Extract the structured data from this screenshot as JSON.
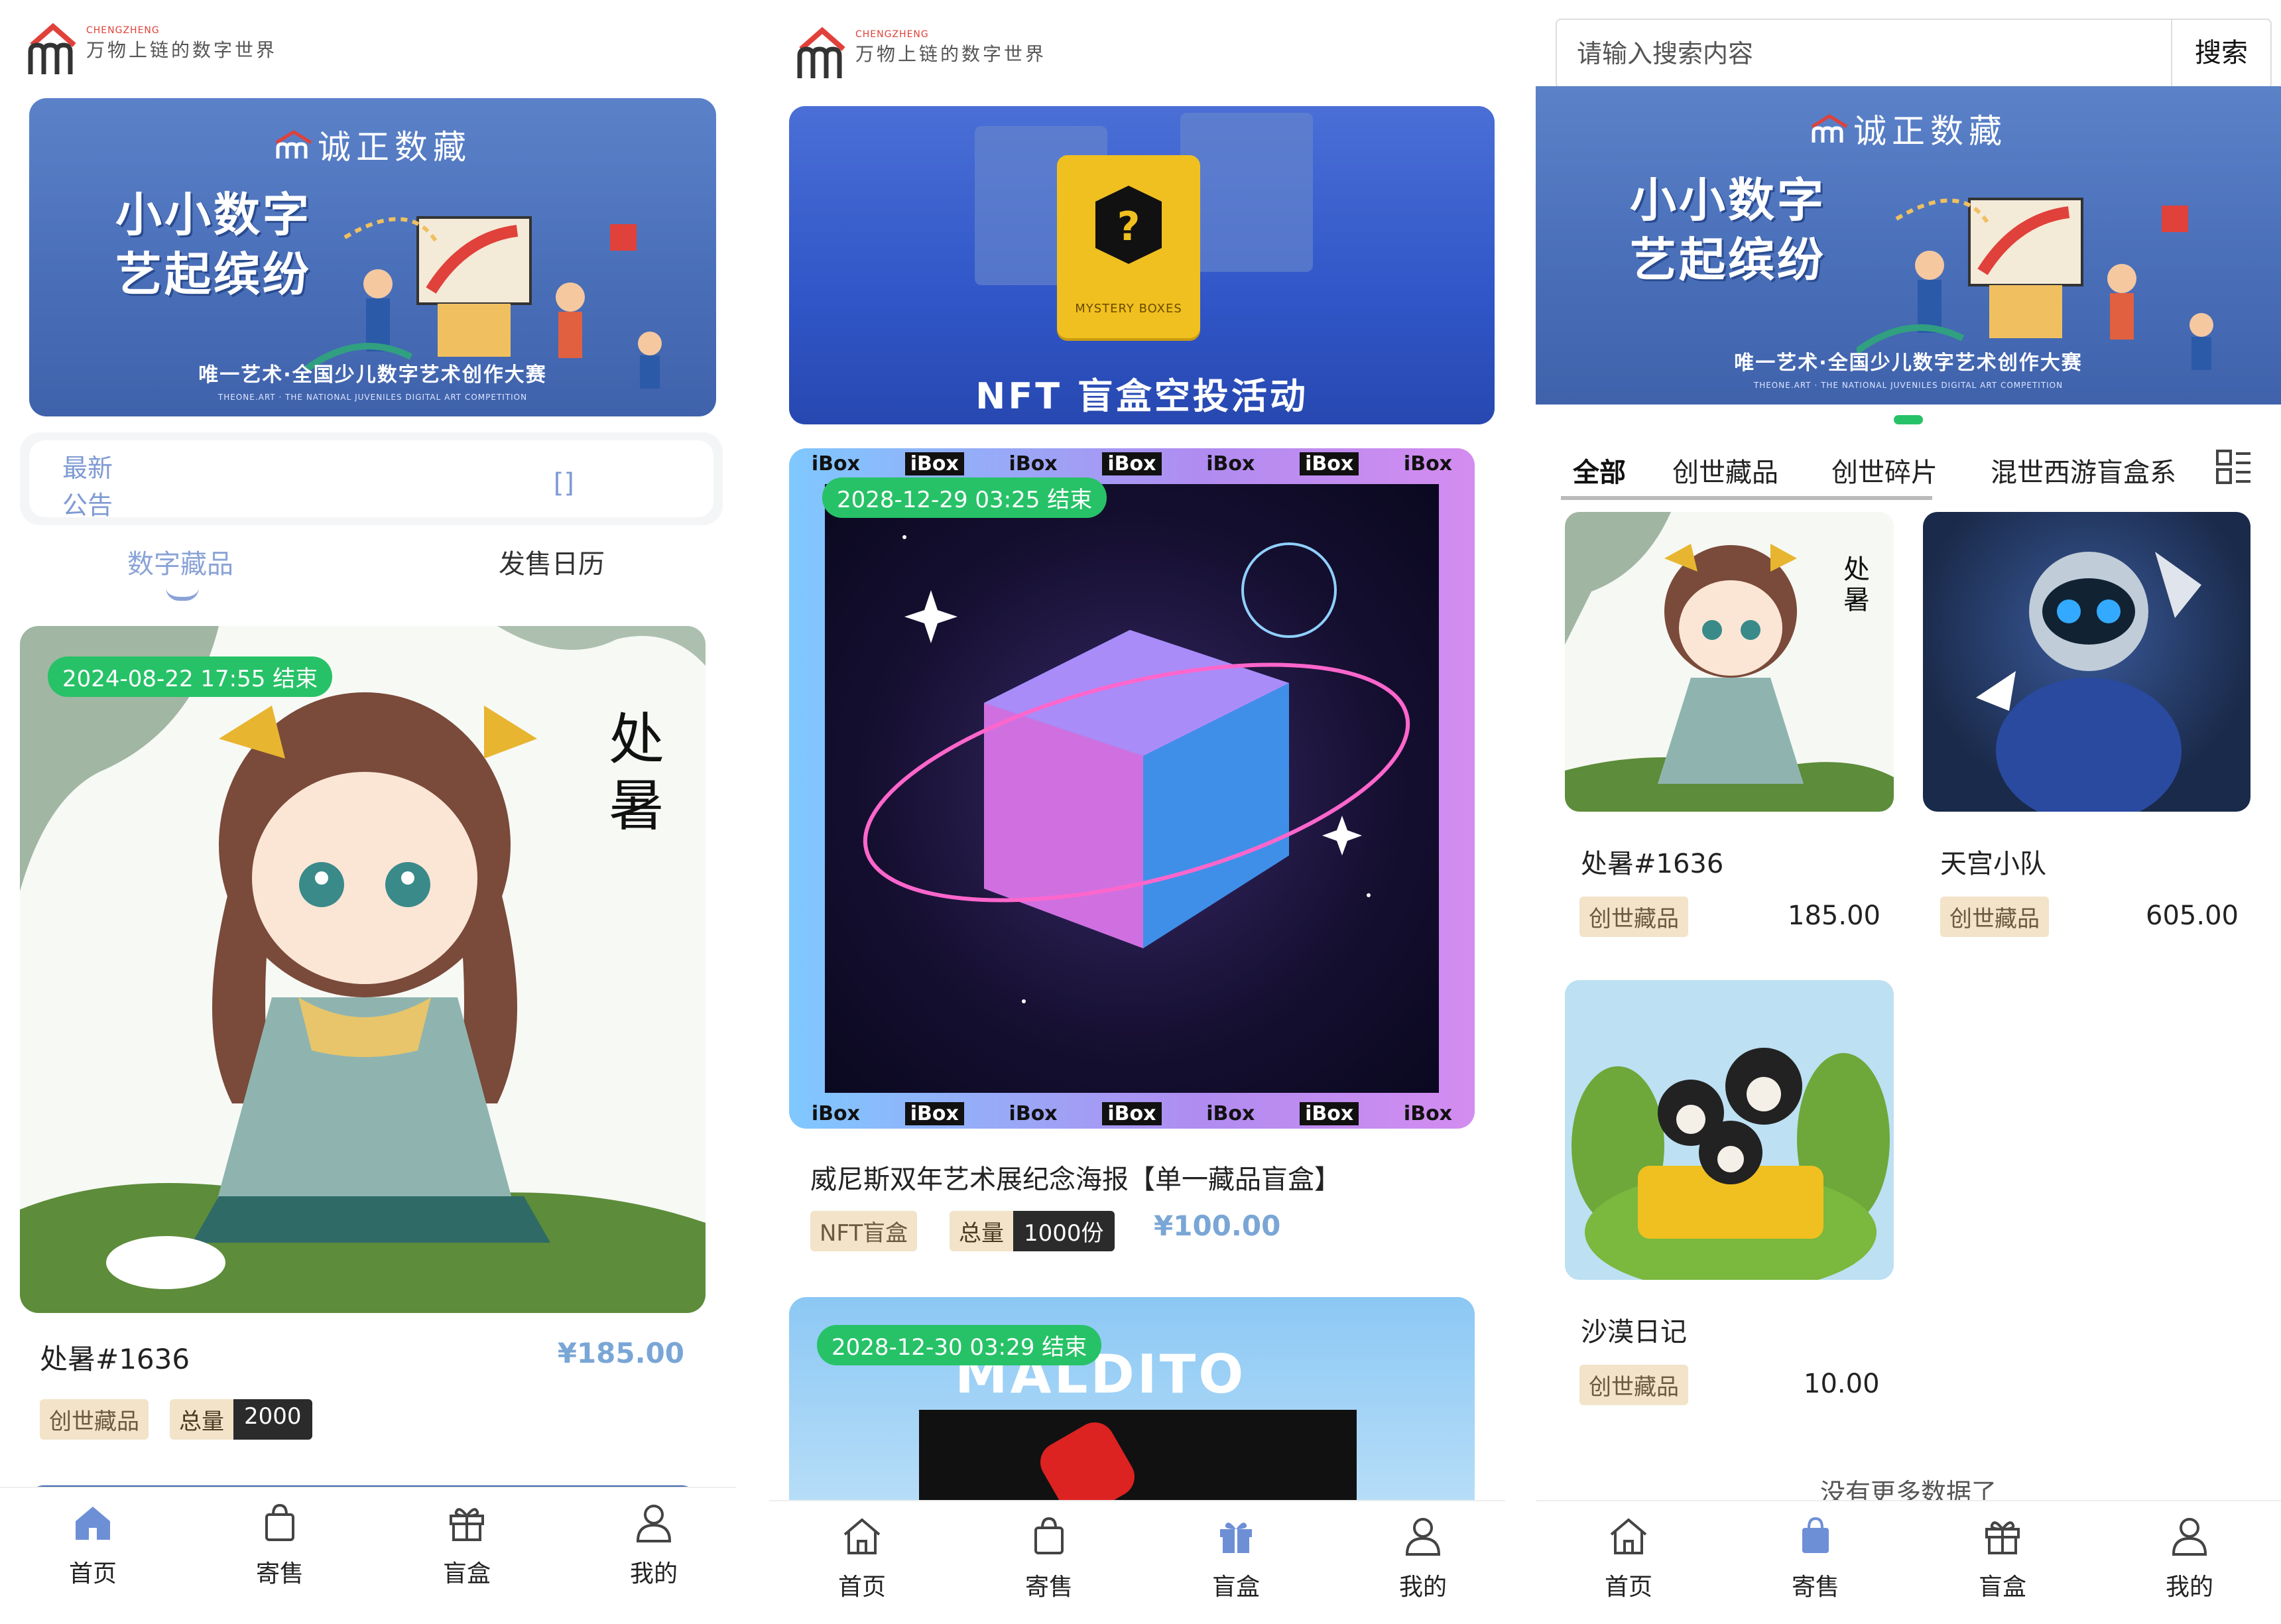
{
  "header": {
    "brand_en": "CHENGZHENG",
    "brand_cn": "万物上链的数字世界"
  },
  "banner": {
    "logo_text": "诚正数藏",
    "title_line1": "小小数字",
    "title_line2": "艺起缤纷",
    "subtitle": "唯一艺术·全国少儿数字艺术创作大赛",
    "subtitle_en": "THEONE.ART · THE NATIONAL JUVENILES DIGITAL ART COMPETITION"
  },
  "screen_home": {
    "notice": {
      "label": "最新公告",
      "icon_text": "[]"
    },
    "tabs": [
      "数字藏品",
      "发售日历"
    ],
    "card": {
      "end_badge": "2024-08-22 17:55 结束",
      "title": "处暑#1636",
      "price": "¥185.00",
      "tag": "创世藏品",
      "total_label": "总量",
      "total_value": "2000"
    }
  },
  "screen_blindbox": {
    "banner_title": "NFT 盲盒空投活动",
    "banner_box_text": "MYSTERY BOXES",
    "card1": {
      "end_badge": "2028-12-29 03:25 结束",
      "title": "威尼斯双年艺术展纪念海报【单一藏品盲盒】",
      "tag": "NFT盲盒",
      "total_label": "总量",
      "total_value": "1000份",
      "price": "¥100.00",
      "frame_text": "iBox"
    },
    "card2": {
      "end_badge": "2028-12-30 03:29 结束",
      "overlay_text": "MALDITO"
    }
  },
  "screen_market": {
    "search": {
      "placeholder": "请输入搜索内容",
      "button": "搜索"
    },
    "categories": [
      "全部",
      "创世藏品",
      "创世碎片",
      "混世西游盲盒系"
    ],
    "items": [
      {
        "title": "处暑#1636",
        "tag": "创世藏品",
        "price": "185.00"
      },
      {
        "title": "天宫小队",
        "tag": "创世藏品",
        "price": "605.00"
      },
      {
        "title": "沙漠日记",
        "tag": "创世藏品",
        "price": "10.00"
      }
    ],
    "no_more": "没有更多数据了"
  },
  "nav": {
    "items": [
      "首页",
      "寄售",
      "盲盒",
      "我的"
    ]
  },
  "colors": {
    "accent_blue": "#8aa3d7",
    "price_blue": "#7aa6d6",
    "badge_green": "#27c267",
    "tag_beige": "#f2e3c9",
    "nav_active_blue": "#6d8fd6"
  }
}
